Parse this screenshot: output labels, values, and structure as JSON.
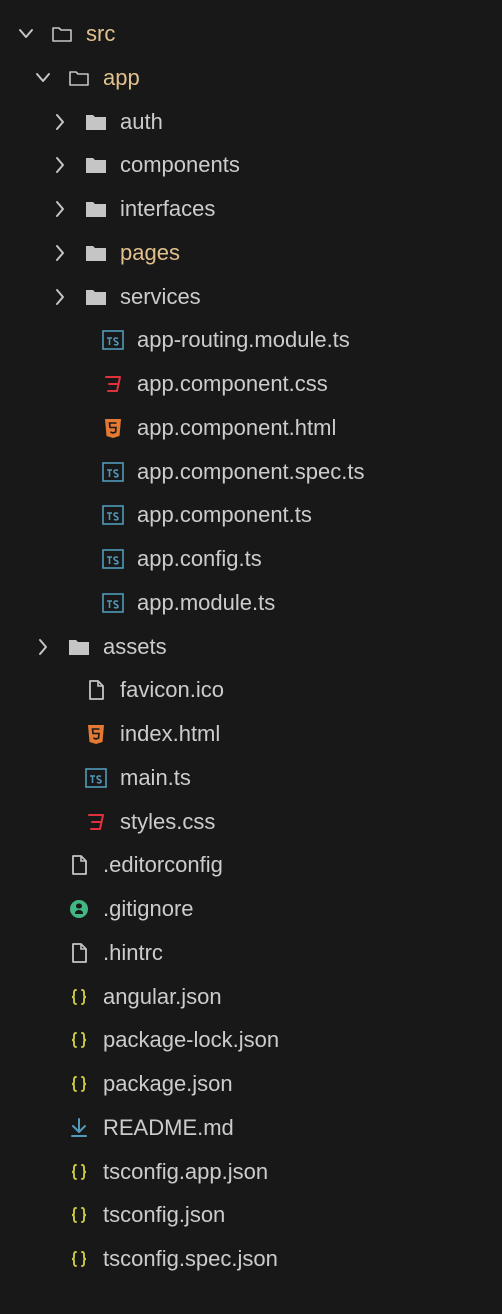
{
  "theme": {
    "background": "#181818",
    "text": "#cccccc",
    "modified_text": "#e2c08d",
    "folder_color": "#c5c5c5",
    "ts_color": "#519aba",
    "css_color": "#e0323c",
    "html_color": "#e37933",
    "json_color": "#cbcb41",
    "markdown_color": "#519aba",
    "generic_file_color": "#c5c5c5",
    "git_color": "#41b883"
  },
  "explorer": {
    "items": [
      {
        "label": "src",
        "kind": "folder-open",
        "icon": "folder-open-icon",
        "depth": 0,
        "modified": true
      },
      {
        "label": "app",
        "kind": "folder-open",
        "icon": "folder-open-icon",
        "depth": 1,
        "modified": true
      },
      {
        "label": "auth",
        "kind": "folder",
        "icon": "folder-icon",
        "depth": 2,
        "modified": false
      },
      {
        "label": "components",
        "kind": "folder",
        "icon": "folder-icon",
        "depth": 2,
        "modified": false
      },
      {
        "label": "interfaces",
        "kind": "folder",
        "icon": "folder-icon",
        "depth": 2,
        "modified": false
      },
      {
        "label": "pages",
        "kind": "folder",
        "icon": "folder-icon",
        "depth": 2,
        "modified": true
      },
      {
        "label": "services",
        "kind": "folder",
        "icon": "folder-icon",
        "depth": 2,
        "modified": false
      },
      {
        "label": "app-routing.module.ts",
        "kind": "ts",
        "icon": "typescript-file-icon",
        "depth": 3,
        "modified": false
      },
      {
        "label": "app.component.css",
        "kind": "css",
        "icon": "css-file-icon",
        "depth": 3,
        "modified": false
      },
      {
        "label": "app.component.html",
        "kind": "html",
        "icon": "html-file-icon",
        "depth": 3,
        "modified": false
      },
      {
        "label": "app.component.spec.ts",
        "kind": "ts",
        "icon": "typescript-file-icon",
        "depth": 3,
        "modified": false
      },
      {
        "label": "app.component.ts",
        "kind": "ts",
        "icon": "typescript-file-icon",
        "depth": 3,
        "modified": false
      },
      {
        "label": "app.config.ts",
        "kind": "ts",
        "icon": "typescript-file-icon",
        "depth": 3,
        "modified": false
      },
      {
        "label": "app.module.ts",
        "kind": "ts",
        "icon": "typescript-file-icon",
        "depth": 3,
        "modified": false
      },
      {
        "label": "assets",
        "kind": "folder",
        "icon": "folder-icon",
        "depth": 1,
        "modified": false
      },
      {
        "label": "favicon.ico",
        "kind": "file",
        "icon": "file-icon",
        "depth": 2,
        "modified": false
      },
      {
        "label": "index.html",
        "kind": "html",
        "icon": "html-file-icon",
        "depth": 2,
        "modified": false
      },
      {
        "label": "main.ts",
        "kind": "ts",
        "icon": "typescript-file-icon",
        "depth": 2,
        "modified": false
      },
      {
        "label": "styles.css",
        "kind": "css",
        "icon": "css-file-icon",
        "depth": 2,
        "modified": false
      },
      {
        "label": ".editorconfig",
        "kind": "file",
        "icon": "file-icon",
        "depth": 1,
        "modified": false
      },
      {
        "label": ".gitignore",
        "kind": "git",
        "icon": "github-icon",
        "depth": 1,
        "modified": false
      },
      {
        "label": ".hintrc",
        "kind": "file",
        "icon": "file-icon",
        "depth": 1,
        "modified": false
      },
      {
        "label": "angular.json",
        "kind": "json",
        "icon": "json-file-icon",
        "depth": 1,
        "modified": false
      },
      {
        "label": "package-lock.json",
        "kind": "json",
        "icon": "json-file-icon",
        "depth": 1,
        "modified": false
      },
      {
        "label": "package.json",
        "kind": "json",
        "icon": "json-file-icon",
        "depth": 1,
        "modified": false
      },
      {
        "label": "README.md",
        "kind": "md",
        "icon": "markdown-file-icon",
        "depth": 1,
        "modified": false
      },
      {
        "label": "tsconfig.app.json",
        "kind": "json",
        "icon": "json-file-icon",
        "depth": 1,
        "modified": false
      },
      {
        "label": "tsconfig.json",
        "kind": "json",
        "icon": "json-file-icon",
        "depth": 1,
        "modified": false
      },
      {
        "label": "tsconfig.spec.json",
        "kind": "json",
        "icon": "json-file-icon",
        "depth": 1,
        "modified": false
      }
    ]
  }
}
